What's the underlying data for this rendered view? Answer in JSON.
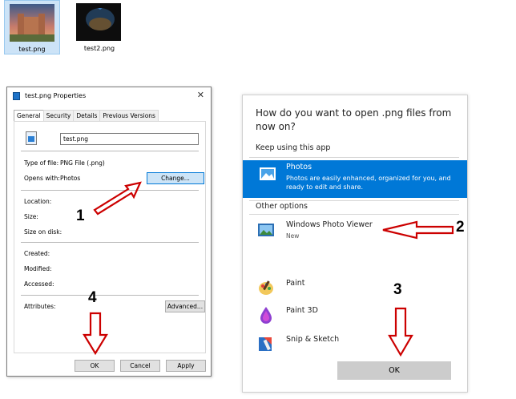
{
  "desktop": {
    "files": [
      {
        "label": "test.png",
        "selected": true,
        "icon": "castle-thumbnail"
      },
      {
        "label": "test2.png",
        "selected": false,
        "icon": "cave-thumbnail"
      }
    ]
  },
  "properties_dialog": {
    "title": "test.png Properties",
    "close_glyph": "✕",
    "tabs": [
      "General",
      "Security",
      "Details",
      "Previous Versions"
    ],
    "active_tab": "General",
    "file_name": "test.png",
    "type_of_file_label": "Type of file:",
    "type_of_file_value": "PNG File (.png)",
    "opens_with_label": "Opens with:",
    "opens_with_value": "Photos",
    "change_button": "Change...",
    "location_label": "Location:",
    "size_label": "Size:",
    "size_on_disk_label": "Size on disk:",
    "created_label": "Created:",
    "modified_label": "Modified:",
    "accessed_label": "Accessed:",
    "attributes_label": "Attributes:",
    "advanced_button": "Advanced...",
    "ok_button": "OK",
    "cancel_button": "Cancel",
    "apply_button": "Apply"
  },
  "open_with": {
    "question": "How do you want to open .png files from now on?",
    "keep_using_header": "Keep using this app",
    "current_app": {
      "name": "Photos",
      "description": "Photos are easily enhanced, organized for you, and ready to edit and share.",
      "icon": "photos-icon"
    },
    "other_options_header": "Other options",
    "apps": [
      {
        "name": "Windows Photo Viewer",
        "sub": "New",
        "icon": "photo-viewer-icon"
      },
      {
        "name": "Paint",
        "sub": "",
        "icon": "paint-icon"
      },
      {
        "name": "Paint 3D",
        "sub": "",
        "icon": "paint-3d-icon"
      },
      {
        "name": "Snip & Sketch",
        "sub": "",
        "icon": "snip-sketch-icon"
      }
    ],
    "ok_button": "OK"
  },
  "annotations": {
    "step_1": "1",
    "step_2": "2",
    "step_3": "3",
    "step_4": "4",
    "arrow_color": "#cc0000"
  },
  "colors": {
    "accent": "#0078d7",
    "selection": "#cce3f7"
  }
}
